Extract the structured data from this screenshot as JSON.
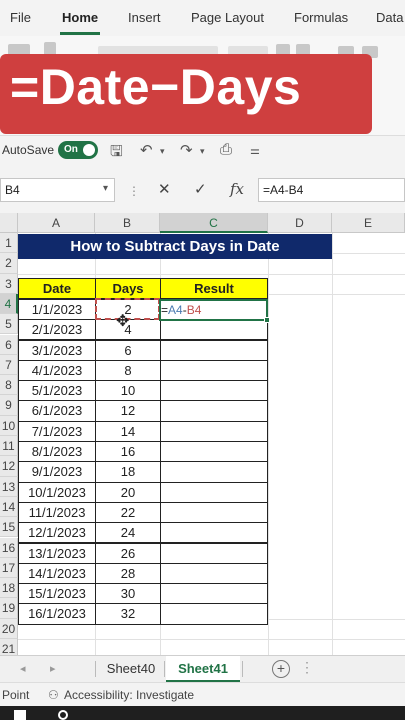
{
  "ribbon": {
    "tabs": [
      "File",
      "Home",
      "Insert",
      "Page Layout",
      "Formulas",
      "Data"
    ],
    "active_tab": "Home"
  },
  "banner": {
    "text": "=Date−Days",
    "color": "#cf3f3f"
  },
  "qat": {
    "autosave_label": "AutoSave",
    "autosave_state": "On"
  },
  "formula_bar": {
    "name_box": "B4",
    "formula": "=A4-B4"
  },
  "grid": {
    "columns": [
      "A",
      "B",
      "C",
      "D",
      "E"
    ],
    "active_column": "C",
    "rows": [
      "1",
      "2",
      "3",
      "4",
      "5",
      "6",
      "7",
      "8",
      "9",
      "10",
      "11",
      "12",
      "13",
      "14",
      "15",
      "16",
      "17",
      "18",
      "19",
      "20",
      "21"
    ],
    "active_row": "4",
    "title": "How to Subtract Days in Date",
    "headers": {
      "date": "Date",
      "days": "Days",
      "result": "Result"
    },
    "dates": [
      "1/1/2023",
      "2/1/2023",
      "3/1/2023",
      "4/1/2023",
      "5/1/2023",
      "6/1/2023",
      "7/1/2023",
      "8/1/2023",
      "9/1/2023",
      "10/1/2023",
      "11/1/2023",
      "12/1/2023",
      "13/1/2023",
      "14/1/2023",
      "15/1/2023",
      "16/1/2023"
    ],
    "days": [
      "2",
      "4",
      "6",
      "8",
      "10",
      "12",
      "14",
      "16",
      "18",
      "20",
      "22",
      "24",
      "26",
      "28",
      "30",
      "32"
    ],
    "editing_formula": {
      "prefix": "=",
      "ref_a": "A4",
      "op": "-",
      "ref_b": "B4"
    }
  },
  "sheets": {
    "tabs": [
      "Sheet40",
      "Sheet41"
    ],
    "active": "Sheet41"
  },
  "status": {
    "mode": "Point",
    "accessibility": "Accessibility: Investigate"
  },
  "colors": {
    "excel_green": "#217346",
    "title_fill": "#10296b",
    "header_fill": "#ffff00"
  }
}
